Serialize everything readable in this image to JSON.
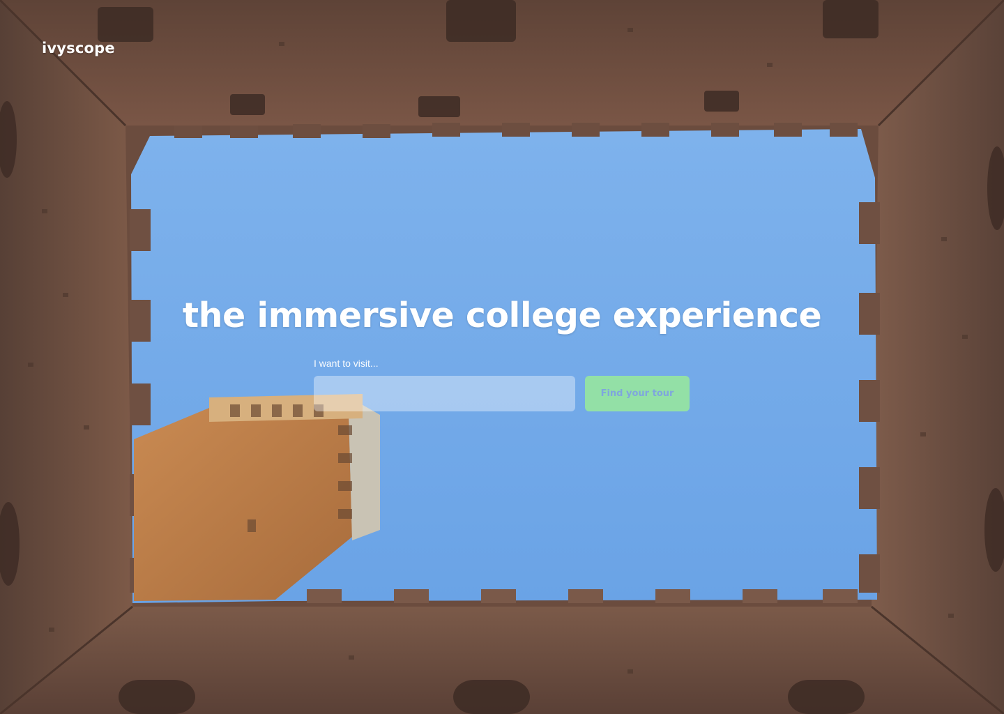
{
  "brand": {
    "name": "ivyscope"
  },
  "hero": {
    "headline": "the immersive college experience",
    "background_image": "looking-up-courtyard-tower-photo"
  },
  "search": {
    "label": "I want to visit...",
    "value": "",
    "placeholder": "",
    "button_label": "Find your tour"
  },
  "colors": {
    "button_bg": "#93e0a6",
    "button_text": "#7fa6dd",
    "sky": "#7aaee9",
    "brick": "#6f4e3f"
  }
}
